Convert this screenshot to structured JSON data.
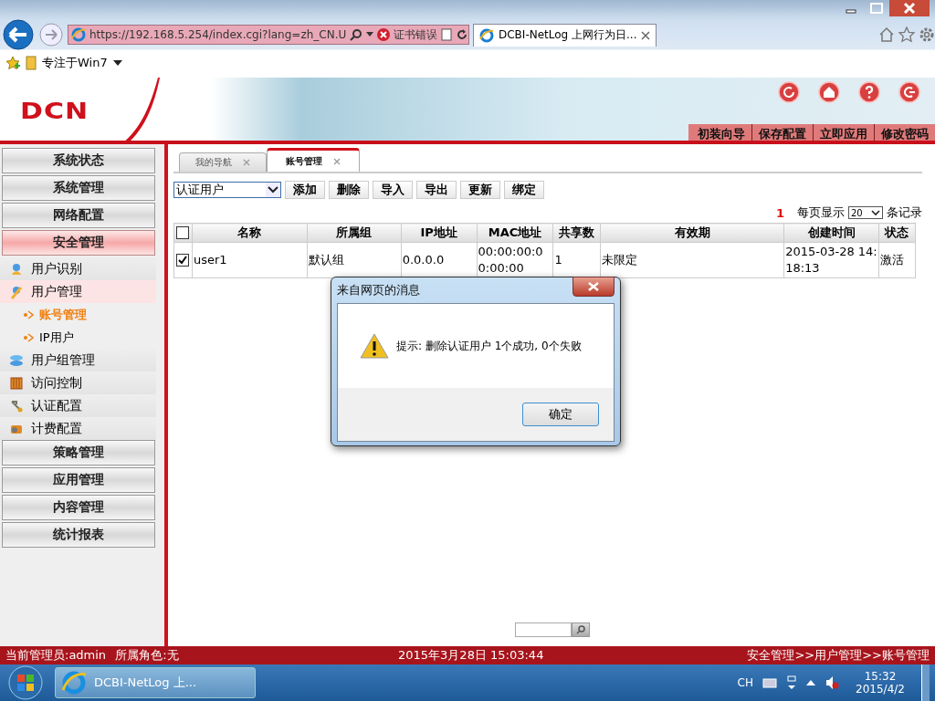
{
  "browser": {
    "url": "https://192.168.5.254/index.cgi?lang=zh_CN.U",
    "cert_error": "证书错误",
    "tab": {
      "title": "DCBI-NetLog 上网行为日...",
      "selected": true
    },
    "favorites": [
      "专注于Win7"
    ]
  },
  "header": {
    "logo": "DCN",
    "actions": [
      "初装向导",
      "保存配置",
      "立即应用",
      "修改密码"
    ]
  },
  "sidebar": {
    "items": [
      {
        "kind": "section",
        "label": "系统状态",
        "selected": false
      },
      {
        "kind": "section",
        "label": "系统管理",
        "selected": false
      },
      {
        "kind": "section",
        "label": "网络配置",
        "selected": false
      },
      {
        "kind": "section",
        "label": "安全管理",
        "selected": true
      },
      {
        "kind": "item",
        "label": "用户识别",
        "selected": false
      },
      {
        "kind": "item",
        "label": "用户管理",
        "selected": true
      },
      {
        "kind": "subitem",
        "label": "账号管理",
        "selected": true
      },
      {
        "kind": "subitem",
        "label": "IP用户",
        "selected": false
      },
      {
        "kind": "item",
        "label": "用户组管理",
        "selected": false
      },
      {
        "kind": "item",
        "label": "访问控制",
        "selected": false
      },
      {
        "kind": "item",
        "label": "认证配置",
        "selected": false
      },
      {
        "kind": "item",
        "label": "计费配置",
        "selected": false
      },
      {
        "kind": "section",
        "label": "策略管理",
        "selected": false
      },
      {
        "kind": "section",
        "label": "应用管理",
        "selected": false
      },
      {
        "kind": "section",
        "label": "内容管理",
        "selected": false
      },
      {
        "kind": "section",
        "label": "统计报表",
        "selected": false
      }
    ]
  },
  "tabs": [
    {
      "label": "我的导航",
      "selected": false
    },
    {
      "label": "账号管理",
      "selected": true
    }
  ],
  "toolbar": {
    "filter": "认证用户",
    "buttons": [
      "添加",
      "删除",
      "导入",
      "导出",
      "更新",
      "绑定"
    ]
  },
  "pager": {
    "count": "1",
    "per_page_label": "每页显示",
    "page_size": "20",
    "suffix": "条记录"
  },
  "table": {
    "select_all": false,
    "columns": [
      "名称",
      "所属组",
      "IP地址",
      "MAC地址",
      "共享数",
      "有效期",
      "创建时间",
      "状态"
    ],
    "rows": [
      {
        "checked": true,
        "cells": [
          "user1",
          "默认组",
          "0.0.0.0",
          "00:00:00:00:00:00",
          "1",
          "未限定",
          "2015-03-28 14:18:13",
          "激活"
        ]
      }
    ]
  },
  "dialog": {
    "title": "来自网页的消息",
    "message": "提示: 删除认证用户 1个成功, 0个失败",
    "button": "确定"
  },
  "status_bar": {
    "admin": "当前管理员:admin",
    "role": "所属角色:无",
    "time": "2015年3月28日 15:03:44",
    "breadcrumb": "安全管理>>用户管理>>账号管理"
  },
  "taskbar": {
    "task": "DCBI-NetLog 上...",
    "lang": "CH",
    "time": "15:32",
    "date": "2015/4/2"
  }
}
